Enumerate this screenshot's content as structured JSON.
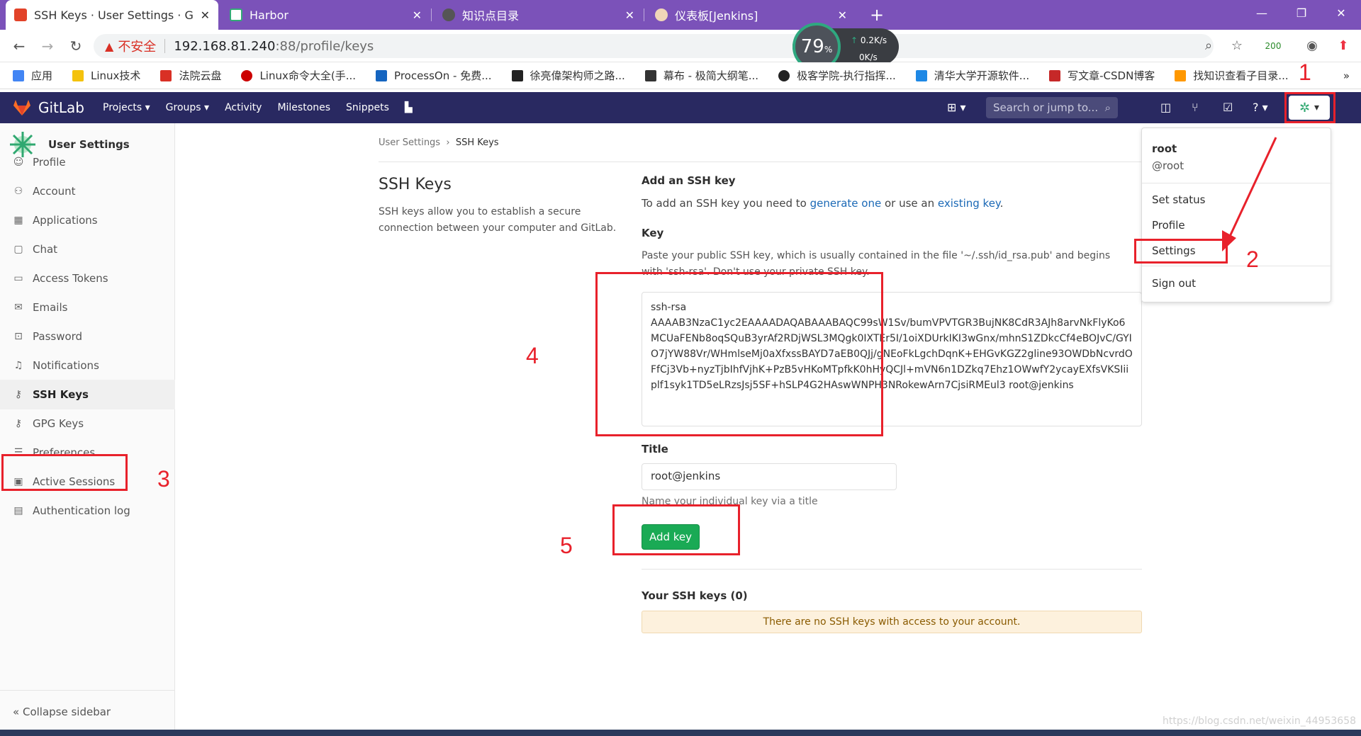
{
  "browser": {
    "tabs": [
      {
        "label": "SSH Keys · User Settings · GitL",
        "close": "✕"
      },
      {
        "label": "Harbor",
        "close": "✕"
      },
      {
        "label": "知识点目录",
        "close": "✕"
      },
      {
        "label": "仪表板[Jenkins]",
        "close": "✕"
      }
    ],
    "new_tab": "+",
    "window_controls": {
      "minimize": "—",
      "maximize": "❐",
      "close": "✕"
    },
    "insecure_label": "不安全",
    "url_host": "192.168.81.240",
    "url_path": ":88/profile/keys",
    "speed": {
      "percent": "79",
      "unit": "%",
      "up": "0.2K/s",
      "down": "0K/s"
    },
    "ext_count": "200",
    "bookmarks": [
      {
        "label": "应用",
        "color": "#4285f4"
      },
      {
        "label": "Linux技术",
        "color": "#f4c20d"
      },
      {
        "label": "法院云盘",
        "color": "#d93025"
      },
      {
        "label": "Linux命令大全(手...",
        "color": "#cc0000"
      },
      {
        "label": "ProcessOn - 免费...",
        "color": "#1565c0"
      },
      {
        "label": "徐亮偉架构师之路...",
        "color": "#222222"
      },
      {
        "label": "幕布 - 极简大纲笔...",
        "color": "#333333"
      },
      {
        "label": "极客学院-执行指挥...",
        "color": "#222222"
      },
      {
        "label": "清华大学开源软件...",
        "color": "#1e88e5"
      },
      {
        "label": "写文章-CSDN博客",
        "color": "#c62828"
      },
      {
        "label": "找知识查看子目录...",
        "color": "#ff9800"
      }
    ],
    "more_bookmarks": "»"
  },
  "gitlab_nav": {
    "brand": "GitLab",
    "menu": [
      "Projects ▾",
      "Groups ▾",
      "Activity",
      "Milestones",
      "Snippets"
    ],
    "search_placeholder": "Search or jump to...",
    "colors": {
      "navbar": "#292961",
      "accent": "#1aaa55"
    }
  },
  "sidebar": {
    "title": "User Settings",
    "items": [
      {
        "label": "Profile",
        "icon": "☺"
      },
      {
        "label": "Account",
        "icon": "⚇"
      },
      {
        "label": "Applications",
        "icon": "▦"
      },
      {
        "label": "Chat",
        "icon": "▢"
      },
      {
        "label": "Access Tokens",
        "icon": "▭"
      },
      {
        "label": "Emails",
        "icon": "✉"
      },
      {
        "label": "Password",
        "icon": "🔒"
      },
      {
        "label": "Notifications",
        "icon": "♫"
      },
      {
        "label": "SSH Keys",
        "icon": "⚷"
      },
      {
        "label": "GPG Keys",
        "icon": "⚷"
      },
      {
        "label": "Preferences",
        "icon": "☰"
      },
      {
        "label": "Active Sessions",
        "icon": "▣"
      },
      {
        "label": "Authentication log",
        "icon": "▤"
      }
    ],
    "active_item": "SSH Keys",
    "collapse_label": "Collapse sidebar"
  },
  "breadcrumb": {
    "parent": "User Settings",
    "sep": "›",
    "current": "SSH Keys"
  },
  "main": {
    "title": "SSH Keys",
    "description": "SSH keys allow you to establish a secure connection between your computer and GitLab.",
    "add_heading": "Add an SSH key",
    "add_text_1": "To add an SSH key you need to ",
    "add_link_1": "generate one",
    "add_text_2": " or use an ",
    "add_link_2": "existing key",
    "add_text_3": ".",
    "key_label": "Key",
    "key_help": "Paste your public SSH key, which is usually contained in the file '~/.ssh/id_rsa.pub' and begins with 'ssh-rsa'. Don't use your private SSH key.",
    "key_value_line1": "ssh-rsa",
    "key_value_body": "AAAAB3NzaC1yc2EAAAADAQABAAABAQC99sW1Sv/bumVPVTGR3BujNK8CdR3AJh8arvNkFlyKo6MCUaFENb8oqSQuB3yrAf2RDjWSL3MQgk0IXTEr5I/1oiXDUrkIKI3wGnx/mhnS1ZDkcCf4eBOJvC/GYIO7jYW88Vr/WHmlseMj0aXfxssBAYD7aEB0QJj/gNEoFkLgchDqnK+EHGvKGZ2gline93OWDbNcvrdOFfCj3Vb+nyzTjbIhfVjhK+PzB5vHKoMTpfkK0hHyQCJl+mVN6n1DZkq7Ehz1OWwfY2ycayEXfsVKSIiiplf1syk1TD5eLRzsJsj5SF+hSLP4G2HAswWNPH3NRokewArn7CjsiRMEul3 root@jenkins",
    "title_label": "Title",
    "title_value": "root@jenkins",
    "title_help": "Name your individual key via a title",
    "add_button": "Add key",
    "your_keys": "Your SSH keys (0)",
    "no_keys": "There are no SSH keys with access to your account."
  },
  "user_dropdown": {
    "name": "root",
    "username": "@root",
    "items": [
      "Set status",
      "Profile",
      "Settings",
      "Sign out"
    ]
  },
  "annotations": [
    "1",
    "2",
    "3",
    "4",
    "5"
  ],
  "watermark": "https://blog.csdn.net/weixin_44953658"
}
